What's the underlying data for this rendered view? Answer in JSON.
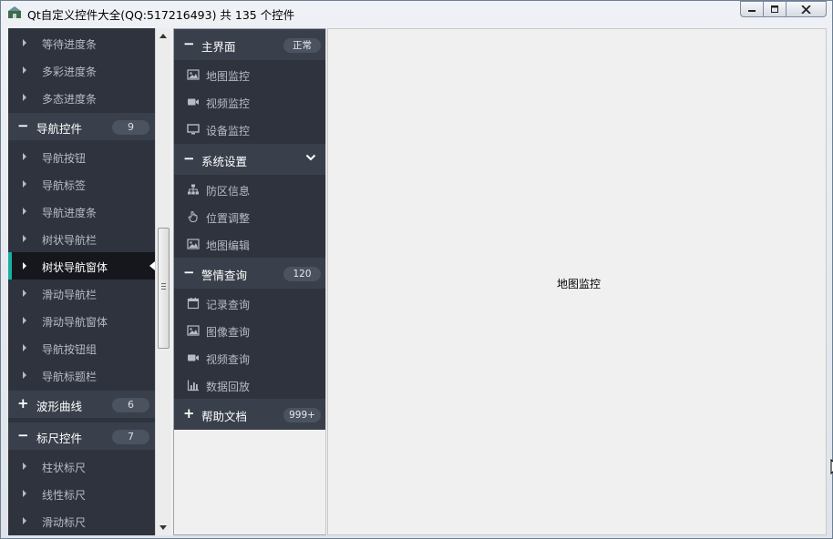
{
  "window": {
    "title": "Qt自定义控件大全(QQ:517216493) 共 135 个控件"
  },
  "left_nav": {
    "items": [
      {
        "type": "item",
        "label": "等待进度条"
      },
      {
        "type": "item",
        "label": "多彩进度条"
      },
      {
        "type": "item",
        "label": "多态进度条"
      },
      {
        "type": "group",
        "sign": "−",
        "label": "导航控件",
        "badge": "9"
      },
      {
        "type": "item",
        "label": "导航按钮"
      },
      {
        "type": "item",
        "label": "导航标签"
      },
      {
        "type": "item",
        "label": "导航进度条"
      },
      {
        "type": "item",
        "label": "树状导航栏"
      },
      {
        "type": "item",
        "label": "树状导航窗体",
        "selected": true
      },
      {
        "type": "item",
        "label": "滑动导航栏"
      },
      {
        "type": "item",
        "label": "滑动导航窗体"
      },
      {
        "type": "item",
        "label": "导航按钮组"
      },
      {
        "type": "item",
        "label": "导航标题栏"
      },
      {
        "type": "group",
        "sign": "+",
        "label": "波形曲线",
        "badge": "6"
      },
      {
        "type": "group",
        "sign": "−",
        "label": "标尺控件",
        "badge": "7"
      },
      {
        "type": "item",
        "label": "柱状标尺"
      },
      {
        "type": "item",
        "label": "线性标尺"
      },
      {
        "type": "item",
        "label": "滑动标尺"
      }
    ]
  },
  "mid_nav": {
    "items": [
      {
        "type": "group",
        "sign": "−",
        "label": "主界面",
        "badge": "正常"
      },
      {
        "type": "item",
        "icon": "image-icon",
        "label": "地图监控"
      },
      {
        "type": "item",
        "icon": "video-icon",
        "label": "视频监控"
      },
      {
        "type": "item",
        "icon": "monitor-icon",
        "label": "设备监控"
      },
      {
        "type": "group",
        "sign": "−",
        "label": "系统设置",
        "chevron": true
      },
      {
        "type": "item",
        "icon": "sitemap-icon",
        "label": "防区信息"
      },
      {
        "type": "item",
        "icon": "hand-pointer-icon",
        "label": "位置调整"
      },
      {
        "type": "item",
        "icon": "image-icon",
        "label": "地图编辑"
      },
      {
        "type": "group",
        "sign": "−",
        "label": "警情查询",
        "badge": "120"
      },
      {
        "type": "item",
        "icon": "calendar-icon",
        "label": "记录查询"
      },
      {
        "type": "item",
        "icon": "image-icon",
        "label": "图像查询"
      },
      {
        "type": "item",
        "icon": "video-icon",
        "label": "视频查询"
      },
      {
        "type": "item",
        "icon": "bar-chart-icon",
        "label": "数据回放"
      },
      {
        "type": "group",
        "sign": "+",
        "label": "帮助文档",
        "badge": "999+"
      }
    ]
  },
  "content": {
    "label": "地图监控"
  },
  "colors": {
    "panel_bg": "#2e333d",
    "group_bg": "#3a404b",
    "selected_bg": "#15171c",
    "accent": "#17b1a3",
    "badge_bg": "#4b5260",
    "item_text": "#b6bcc6"
  }
}
